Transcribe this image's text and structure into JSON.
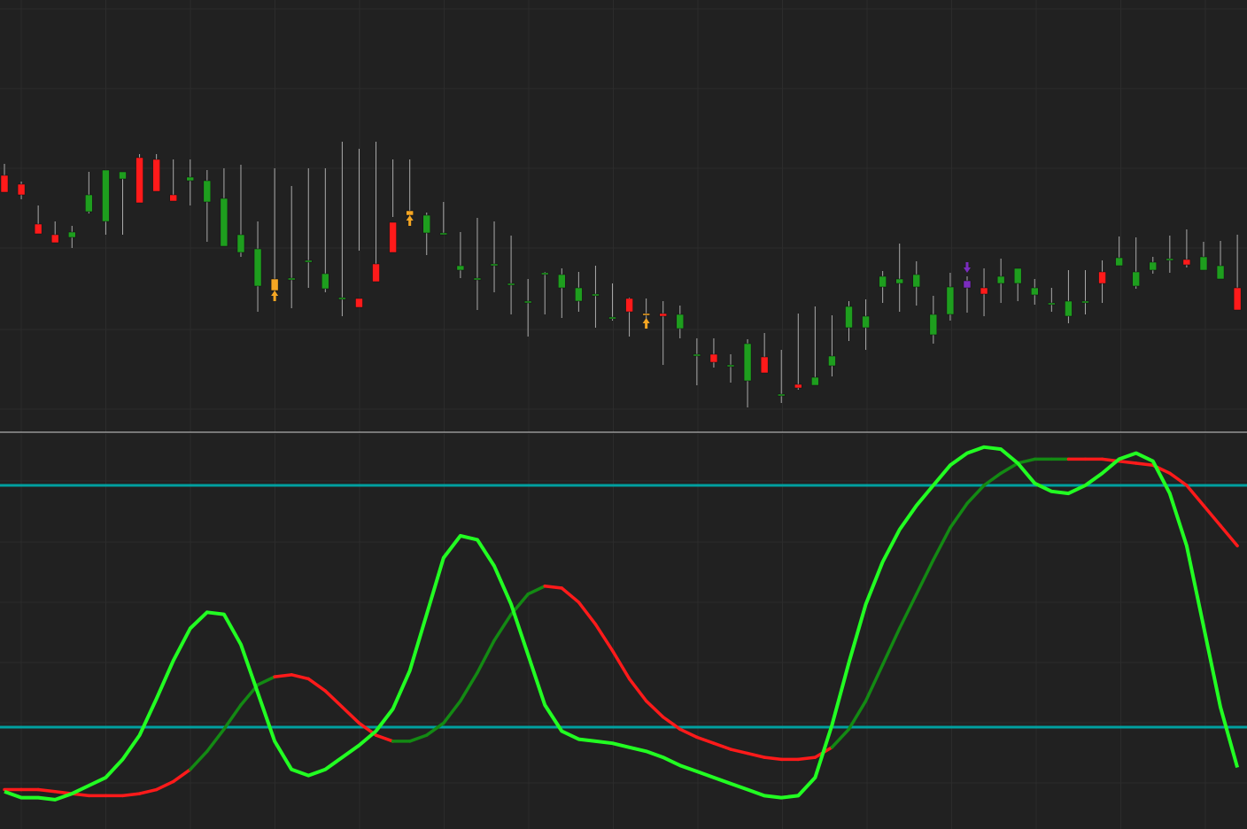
{
  "colors": {
    "background": "#212121",
    "grid": "#2c2c2c",
    "divider": "#d0d0d0",
    "bull": "#1e9e1e",
    "bear": "#ff1a1a",
    "signal_up": "#f5a623",
    "signal_down": "#7b2cbf",
    "wick": "#aaaaaa",
    "fast_line": "#22ff22",
    "slow_up": "#138a13",
    "slow_down": "#ff1a1a",
    "level_line": "#00a0a0"
  },
  "chart_data": [
    {
      "type": "candlestick",
      "title": "",
      "xlabel": "",
      "ylabel": "",
      "ylim": [
        0,
        490
      ],
      "grid": true,
      "x": [
        1,
        2,
        3,
        4,
        5,
        6,
        7,
        8,
        9,
        10,
        11,
        12,
        13,
        14,
        15,
        16,
        17,
        18,
        19,
        20,
        21,
        22,
        23,
        24,
        25,
        26,
        27,
        28,
        29,
        30,
        31,
        32,
        33,
        34,
        35,
        36,
        37,
        38,
        39,
        40,
        41,
        42,
        43,
        44,
        45,
        46,
        47,
        48,
        49,
        50,
        51,
        52,
        53,
        54,
        55,
        56,
        57,
        58,
        59,
        60,
        61,
        62,
        63,
        64,
        65,
        66,
        67,
        68,
        69,
        70,
        71,
        72,
        73,
        74
      ],
      "open": [
        292,
        282,
        237,
        225,
        222,
        251,
        240,
        288,
        312,
        310,
        270,
        286,
        262,
        212,
        205,
        167,
        175,
        176,
        195,
        164,
        152,
        153,
        192,
        239,
        247,
        227,
        226,
        185,
        174,
        192,
        170,
        150,
        182,
        165,
        150,
        158,
        132,
        153,
        136,
        136,
        119,
        90,
        90,
        78,
        60,
        87,
        45,
        56,
        55,
        77,
        120,
        120,
        166,
        170,
        166,
        112,
        135,
        165,
        165,
        170,
        170,
        157,
        148,
        133,
        150,
        183,
        190,
        167,
        185,
        196,
        197,
        185,
        175,
        165
      ],
      "high": [
        305,
        285,
        258,
        240,
        235,
        296,
        264,
        296,
        316,
        316,
        310,
        310,
        298,
        300,
        304,
        240,
        300,
        280,
        300,
        300,
        330,
        322,
        330,
        310,
        310,
        250,
        262,
        228,
        244,
        240,
        224,
        175,
        183,
        187,
        183,
        190,
        170,
        154,
        153,
        150,
        145,
        108,
        108,
        90,
        107,
        114,
        95,
        136,
        144,
        134,
        150,
        152,
        184,
        215,
        195,
        156,
        182,
        178,
        187,
        198,
        184,
        175,
        165,
        185,
        185,
        196,
        223,
        222,
        200,
        224,
        231,
        217,
        218,
        225
      ],
      "low": [
        275,
        265,
        228,
        218,
        210,
        249,
        225,
        225,
        283,
        295,
        265,
        258,
        217,
        215,
        200,
        138,
        150,
        142,
        165,
        160,
        133,
        207,
        184,
        245,
        235,
        202,
        225,
        176,
        140,
        160,
        135,
        110,
        135,
        131,
        138,
        120,
        128,
        110,
        119,
        78,
        108,
        55,
        75,
        58,
        30,
        80,
        35,
        50,
        60,
        65,
        105,
        95,
        148,
        138,
        145,
        102,
        128,
        137,
        133,
        148,
        150,
        146,
        138,
        125,
        135,
        148,
        190,
        164,
        181,
        182,
        188,
        185,
        175,
        150
      ],
      "close": [
        273,
        270,
        226,
        216,
        228,
        270,
        298,
        296,
        261,
        274,
        263,
        290,
        286,
        266,
        225,
        209,
        162,
        176,
        196,
        181,
        154,
        143,
        172,
        205,
        252,
        247,
        227,
        190,
        176,
        192,
        170,
        150,
        182,
        180,
        165,
        158,
        132,
        138,
        136,
        133,
        135,
        90,
        81,
        78,
        102,
        69,
        45,
        52,
        64,
        88,
        144,
        133,
        178,
        175,
        180,
        135,
        166,
        173,
        158,
        178,
        187,
        165,
        148,
        150,
        150,
        170,
        199,
        183,
        194,
        198,
        191,
        200,
        190,
        140
      ],
      "signals_up": [
        17,
        25,
        39
      ],
      "signals_down": [
        58
      ]
    },
    {
      "type": "line",
      "title": "",
      "xlabel": "",
      "ylabel": "",
      "ylim": [
        0,
        100
      ],
      "grid": true,
      "x": [
        1,
        2,
        3,
        4,
        5,
        6,
        7,
        8,
        9,
        10,
        11,
        12,
        13,
        14,
        15,
        16,
        17,
        18,
        19,
        20,
        21,
        22,
        23,
        24,
        25,
        26,
        27,
        28,
        29,
        30,
        31,
        32,
        33,
        34,
        35,
        36,
        37,
        38,
        39,
        40,
        41,
        42,
        43,
        44,
        45,
        46,
        47,
        48,
        49,
        50,
        51,
        52,
        53,
        54,
        55,
        56,
        57,
        58,
        59,
        60,
        61,
        62,
        63,
        64,
        65,
        66,
        67,
        68,
        69,
        70,
        71,
        72,
        73,
        74
      ],
      "levels": [
        80,
        20
      ],
      "series": [
        {
          "values": [
            4.0,
            2.5,
            2.5,
            2.0,
            3.5,
            5.5,
            7.5,
            12.0,
            18.0,
            27.0,
            36.5,
            44.5,
            48.5,
            48.0,
            40.5,
            28.5,
            16.5,
            9.5,
            8.0,
            9.5,
            12.5,
            15.5,
            19.0,
            24.5,
            34.0,
            48.0,
            62.0,
            67.5,
            66.5,
            60.0,
            50.5,
            38.0,
            25.5,
            19.0,
            17.0,
            16.5,
            16.0,
            15.0,
            14.0,
            12.5,
            10.5,
            9.0,
            7.5,
            6.0,
            4.5,
            3.0,
            2.5,
            3.0,
            7.5,
            20.5,
            36.0,
            50.5,
            61.0,
            69.0,
            75.0,
            80.0,
            85.0,
            88.0,
            89.5,
            89.0,
            85.5,
            80.5,
            78.5,
            78.0,
            80.0,
            83.0,
            86.5,
            88.0,
            86.0,
            78.0,
            65.0,
            45.0,
            25.0,
            10.0
          ]
        },
        {
          "values": [
            4.5,
            4.5,
            4.5,
            4.0,
            3.5,
            3.0,
            3.0,
            3.0,
            3.5,
            4.5,
            6.5,
            9.5,
            14.0,
            19.5,
            25.5,
            30.5,
            32.5,
            33.0,
            32.0,
            29.0,
            25.0,
            21.0,
            18.0,
            16.5,
            16.5,
            18.0,
            21.0,
            26.5,
            33.5,
            41.5,
            48.0,
            53.0,
            55.0,
            54.5,
            51.0,
            45.5,
            39.0,
            32.0,
            26.5,
            22.5,
            19.5,
            17.5,
            16.0,
            14.5,
            13.5,
            12.5,
            12.0,
            12.0,
            12.5,
            15.0,
            19.5,
            26.5,
            35.5,
            44.5,
            53.0,
            61.5,
            69.5,
            75.5,
            80.0,
            83.0,
            85.5,
            86.5,
            86.5,
            86.5,
            86.5,
            86.5,
            86.0,
            85.5,
            85.0,
            83.0,
            80.0,
            75.0,
            70.0,
            65.0
          ],
          "down_ranges": [
            [
              1,
              12
            ],
            [
              17,
              24
            ],
            [
              33,
              50
            ],
            [
              64,
              74
            ]
          ]
        }
      ]
    }
  ]
}
